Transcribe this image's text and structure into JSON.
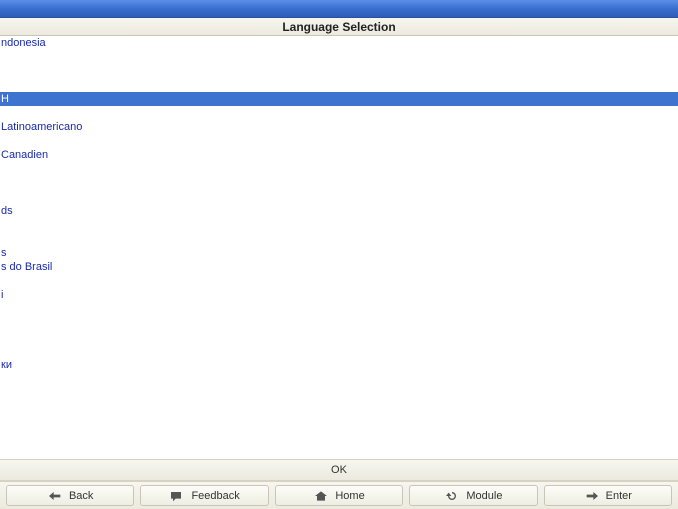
{
  "title": "Language Selection",
  "selectedIndex": 4,
  "languages": [
    "ndonesia",
    "",
    "",
    "",
    "H",
    "",
    "Latinoamericano",
    "",
    "Canadien",
    "",
    "",
    "",
    "ds",
    "",
    "",
    "s",
    "s do Brasil",
    "",
    "i",
    "",
    "",
    "",
    "",
    "ки",
    "",
    "",
    "",
    "",
    ""
  ],
  "ok_label": "OK",
  "nav": {
    "back": "Back",
    "feedback": "Feedback",
    "home": "Home",
    "module": "Module",
    "enter": "Enter"
  }
}
